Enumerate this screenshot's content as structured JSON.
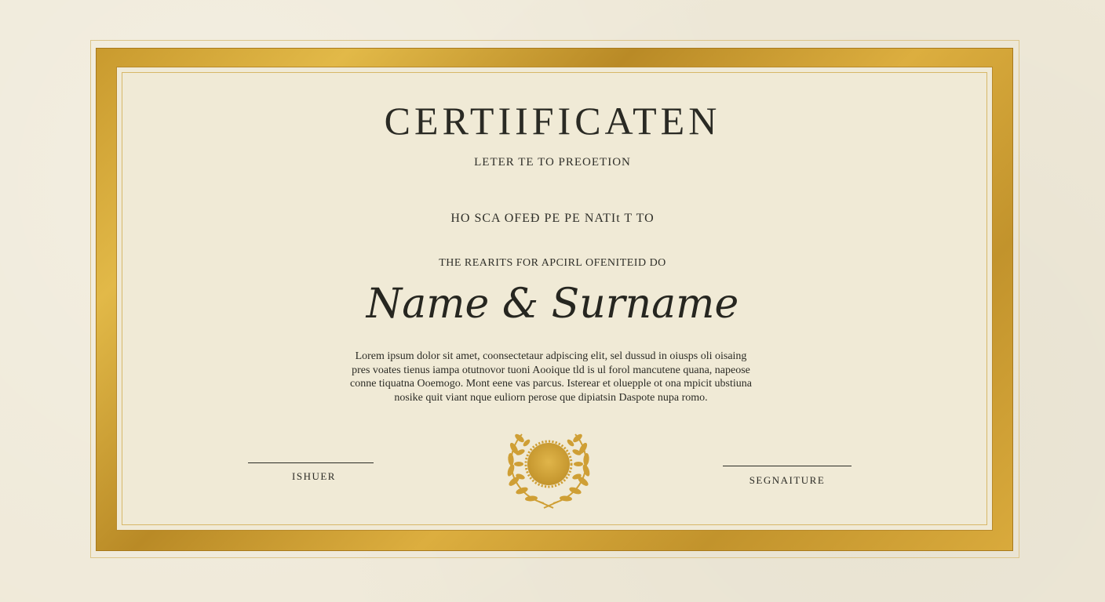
{
  "certificate": {
    "title": "CERTIIFICATEN",
    "subtitle": "LETER TE TO PREOETION",
    "presented_line": "HO SCA OFEÐ PE PE NATIt T TO",
    "reason_line": "THE REARITS FOR APCIRL OFENITEID DO",
    "recipient_name": "Name & Surname",
    "body_lines": [
      "Lorem ipsum dolor sit amet, coonsectetaur adpiscing elit, sel dussud in oiusps oli oisaing",
      "pres voates tienus iampa otutnovor tuoni Aooique tld is ul forol mancutene quana, napeose",
      "conne tiquatna Ooemogo. Mont eene vas parcus. Isterear et oluepple ot ona mpicit ubstiuna",
      "nosike quit viant nque euliorn perose que dipiatsin Daspote nupa romo."
    ],
    "issuer_label": "ISHUER",
    "signature_label": "SEGNAITURE"
  },
  "icons": {
    "seal": "gold-laurel-seal-icon"
  },
  "colors": {
    "paper": "#efe9d8",
    "gold": "#d1a33a",
    "gold_dark": "#b98a26",
    "ink": "#2a2a24"
  }
}
